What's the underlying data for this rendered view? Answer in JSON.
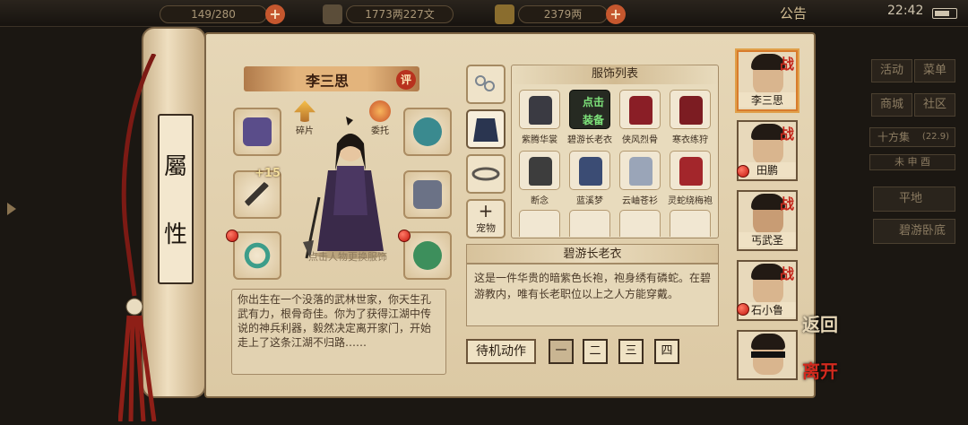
{
  "topbar": {
    "stamina": "149/280",
    "money": "1773两227文",
    "gold": "2379两",
    "notice": "公告",
    "clock": "22:42",
    "plus": "+"
  },
  "scroll_tag": [
    "屬",
    "性"
  ],
  "character": {
    "name": "李三思",
    "review_badge": "评",
    "fragment_label": "碎片",
    "commission_label": "委托",
    "enhance_level": "+15",
    "hint": "点击人物更换服饰",
    "bio": "你出生在一个没落的武林世家，你天生孔武有力，根骨奇佳。你为了获得江湖中传说的神兵利器，毅然决定离开家门，开始走上了这条江湖不归路……"
  },
  "tabs": {
    "pet_plus": "+",
    "pet_label": "宠物"
  },
  "costume_list": {
    "title": "服饰列表",
    "selected_text": [
      "点击",
      "装备"
    ],
    "items": [
      {
        "label": "紫腾华裳",
        "color": "#3a3a42"
      },
      {
        "label": "碧游长老衣",
        "color": "#2d2b33"
      },
      {
        "label": "侠风烈骨",
        "color": "#8a1e26"
      },
      {
        "label": "寒衣练狩",
        "color": "#7c1c22"
      },
      {
        "label": "断念",
        "color": "#3d3d3d"
      },
      {
        "label": "蓝溪梦",
        "color": "#3b4c74"
      },
      {
        "label": "云岫苍衫",
        "color": "#9aa5b8"
      },
      {
        "label": "灵蛇绕梅袍",
        "color": "#a3262b"
      }
    ]
  },
  "costume_detail": {
    "title": "碧游长老衣",
    "description": "这是一件华贵的暗紫色长袍，袍身绣有磷蛇。在碧游教内，唯有长老职位以上之人方能穿戴。"
  },
  "actions": {
    "idle_label": "待机动作",
    "poses": [
      "一",
      "二",
      "三",
      "四"
    ]
  },
  "team": [
    {
      "name": "李三思",
      "war": "战"
    },
    {
      "name": "田鹏",
      "war": "战"
    },
    {
      "name": "丐武圣",
      "war": "战"
    },
    {
      "name": "石小鲁",
      "war": "战"
    },
    {
      "name": "",
      "war": ""
    }
  ],
  "nav": {
    "back": "返回",
    "leave": "离开"
  },
  "side_menu": {
    "buttons": [
      "活动",
      "菜单",
      "商城",
      "社区"
    ],
    "region": "十方集",
    "region_num": "(22.9)",
    "time_row": "未  申  酉",
    "locations": [
      "平地",
      "碧游卧底"
    ]
  }
}
